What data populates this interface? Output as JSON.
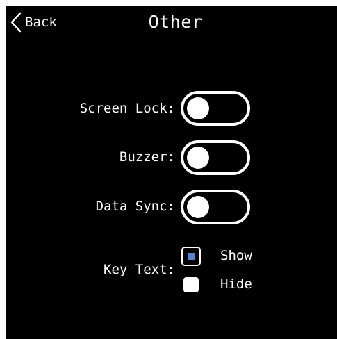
{
  "header": {
    "back_label": "Back",
    "title": "Other"
  },
  "settings": {
    "screen_lock": {
      "label": "Screen Lock:",
      "enabled": false
    },
    "buzzer": {
      "label": "Buzzer:",
      "enabled": false
    },
    "data_sync": {
      "label": "Data Sync:",
      "enabled": false
    },
    "key_text": {
      "label": "Key Text:",
      "options": [
        {
          "label": "Show",
          "selected": true
        },
        {
          "label": "Hide",
          "selected": false
        }
      ]
    }
  },
  "colors": {
    "background": "#000000",
    "foreground": "#ffffff",
    "accent": "#4f86d6"
  }
}
